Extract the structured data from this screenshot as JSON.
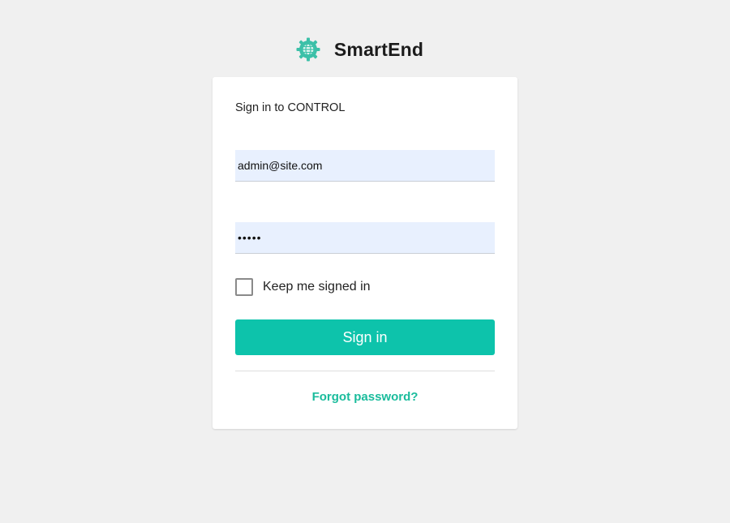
{
  "brand": {
    "name": "SmartEnd",
    "logo_icon": "gear-globe-icon",
    "logo_color": "#3cc0a8"
  },
  "login": {
    "title": "Sign in to CONTROL",
    "email_value": "admin@site.com",
    "password_value": "•••••",
    "remember_label": "Keep me signed in",
    "remember_checked": false,
    "submit_label": "Sign in",
    "forgot_label": "Forgot password?"
  },
  "colors": {
    "accent": "#0dc3ab",
    "link": "#1abc9c",
    "background": "#f0f0f0",
    "input_fill": "#e8f0fe"
  }
}
